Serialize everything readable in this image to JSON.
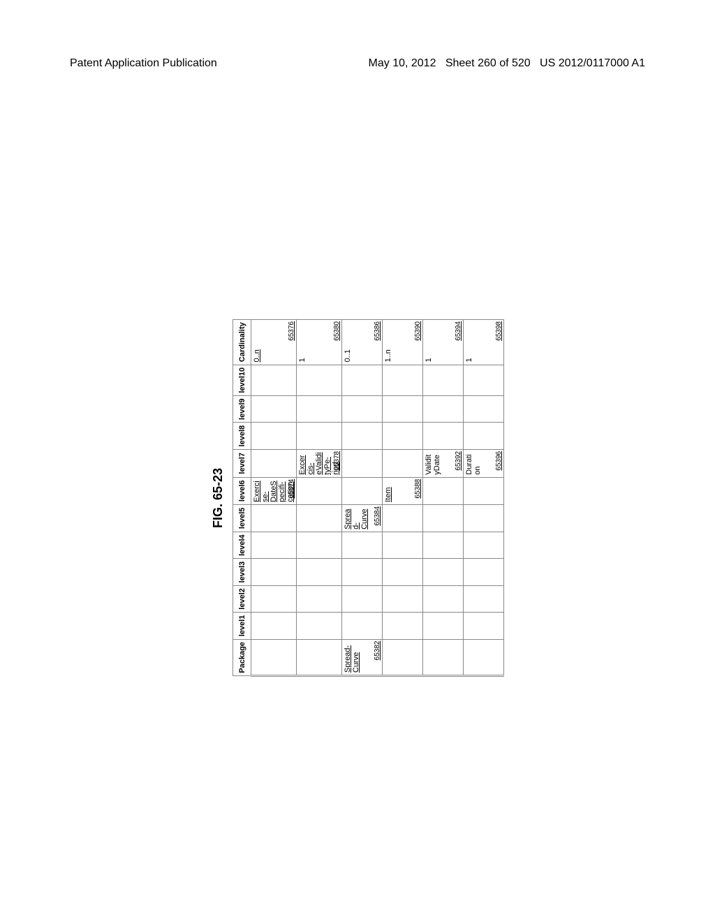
{
  "header": {
    "left": "Patent Application Publication",
    "right_date": "May 10, 2012",
    "right_sheet": "Sheet 260 of 520",
    "right_pubno": "US 2012/0117000 A1"
  },
  "figure_label": "FIG. 65-23",
  "columns": [
    "Package",
    "level1",
    "level2",
    "level3",
    "level4",
    "level5",
    "level6",
    "level7",
    "level8",
    "level9",
    "level10",
    "Cardinality"
  ],
  "rows": [
    {
      "package": "",
      "l1": "",
      "l2": "",
      "l3": "",
      "l4": "",
      "l5": "",
      "l6": "Exercise-DateSpecifi-cation",
      "l6ref": "65374",
      "l7": "",
      "l8": "",
      "l9": "",
      "l10": "",
      "card": "0..n",
      "cardref": "65376"
    },
    {
      "package": "",
      "l1": "",
      "l2": "",
      "l3": "",
      "l4": "",
      "l5": "",
      "l6": "",
      "l7": "Excercis-eValidityPe-riod",
      "l7ref": "65378",
      "l8": "",
      "l9": "",
      "l10": "",
      "card": "1",
      "cardref": "65380"
    },
    {
      "package": "Spread-Curve",
      "packref": "65382",
      "l1": "",
      "l2": "",
      "l3": "",
      "l4": "",
      "l5": "Spread-Curve",
      "l5ref": "65384",
      "l6": "",
      "l7": "",
      "l8": "",
      "l9": "",
      "l10": "",
      "card": "0..1",
      "cardref": "65386"
    },
    {
      "package": "",
      "l1": "",
      "l2": "",
      "l3": "",
      "l4": "",
      "l5": "",
      "l6": "Item",
      "l6ref": "65388",
      "l7": "",
      "l8": "",
      "l9": "",
      "l10": "",
      "card": "1..n",
      "cardref": "65390"
    },
    {
      "package": "",
      "l1": "",
      "l2": "",
      "l3": "",
      "l4": "",
      "l5": "",
      "l6": "",
      "l7": "ValidityDate",
      "l7ref": "65392",
      "l8": "",
      "l9": "",
      "l10": "",
      "card": "1",
      "cardref": "65394"
    },
    {
      "package": "",
      "l1": "",
      "l2": "",
      "l3": "",
      "l4": "",
      "l5": "",
      "l6": "",
      "l7": "Duration",
      "l7ref": "65396",
      "l8": "",
      "l9": "",
      "l10": "",
      "card": "1",
      "cardref": "65398"
    }
  ],
  "chart_data": {
    "type": "table",
    "title": "FIG. 65-23",
    "columns": [
      "Package",
      "level1",
      "level2",
      "level3",
      "level4",
      "level5",
      "level6",
      "level7",
      "level8",
      "level9",
      "level10",
      "Cardinality"
    ],
    "data": [
      {
        "Package": "",
        "level6": "ExerciseDateSpecification",
        "ref_level6": 65374,
        "Cardinality": "0..n",
        "ref_card": 65376
      },
      {
        "Package": "",
        "level7": "ExcerciseValidityPeriod",
        "ref_level7": 65378,
        "Cardinality": "1",
        "ref_card": 65380
      },
      {
        "Package": "SpreadCurve",
        "ref_package": 65382,
        "level5": "SpreadCurve",
        "ref_level5": 65384,
        "Cardinality": "0..1",
        "ref_card": 65386
      },
      {
        "Package": "",
        "level6": "Item",
        "ref_level6": 65388,
        "Cardinality": "1..n",
        "ref_card": 65390
      },
      {
        "Package": "",
        "level7": "ValidityDate",
        "ref_level7": 65392,
        "Cardinality": "1",
        "ref_card": 65394
      },
      {
        "Package": "",
        "level7": "Duration",
        "ref_level7": 65396,
        "Cardinality": "1",
        "ref_card": 65398
      }
    ]
  }
}
